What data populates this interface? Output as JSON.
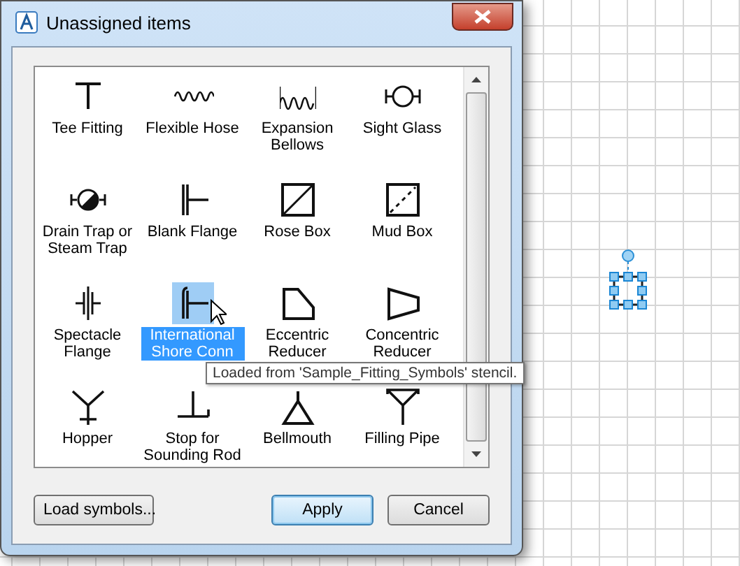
{
  "window": {
    "title": "Unassigned items"
  },
  "items": [
    {
      "label": "Tee Fitting",
      "selected": false
    },
    {
      "label": "Flexible Hose",
      "selected": false
    },
    {
      "label": "Expansion Bellows",
      "selected": false
    },
    {
      "label": "Sight Glass",
      "selected": false
    },
    {
      "label": "Drain Trap or Steam Trap",
      "selected": false
    },
    {
      "label": "Blank Flange",
      "selected": false
    },
    {
      "label": "Rose Box",
      "selected": false
    },
    {
      "label": "Mud Box",
      "selected": false
    },
    {
      "label": "Spectacle Flange",
      "selected": false
    },
    {
      "label": "International Shore Conn",
      "selected": true
    },
    {
      "label": "Eccentric Reducer",
      "selected": false
    },
    {
      "label": "Concentric Reducer",
      "selected": false
    },
    {
      "label": "Hopper",
      "selected": false
    },
    {
      "label": "Stop for Sounding Rod",
      "selected": false
    },
    {
      "label": "Bellmouth",
      "selected": false
    },
    {
      "label": "Filling Pipe",
      "selected": false
    }
  ],
  "tooltip": "Loaded from 'Sample_Fitting_Symbols' stencil.",
  "buttons": [
    {
      "label": "Load symbols...",
      "default": false
    },
    {
      "label": "Apply",
      "default": true
    },
    {
      "label": "Cancel",
      "default": false
    }
  ]
}
